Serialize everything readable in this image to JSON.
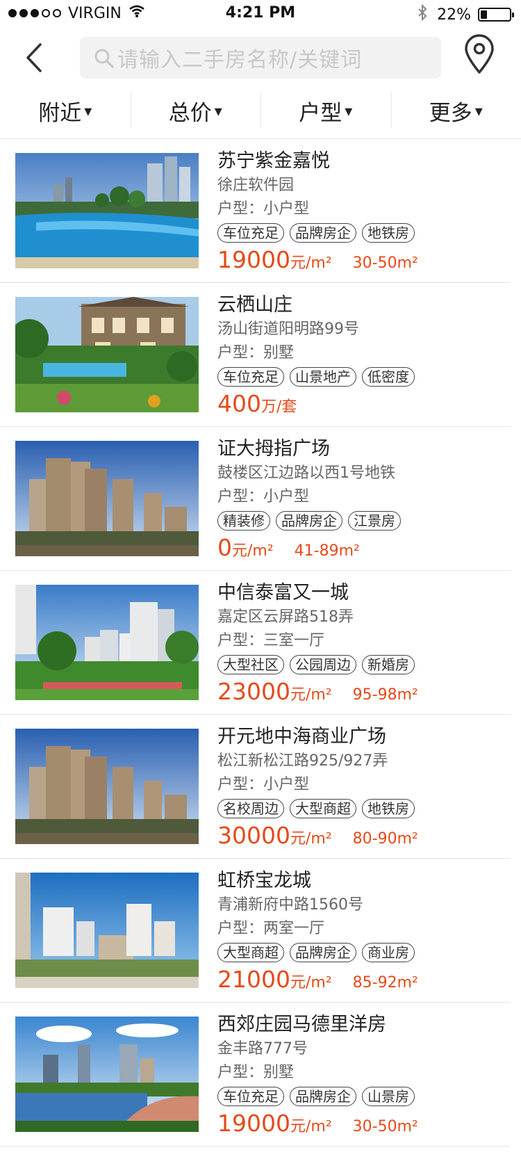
{
  "status_bar": {
    "carrier": "VIRGIN",
    "time": "4:21 PM",
    "battery_text": "22%",
    "battery_level": 0.22,
    "signal_dots_filled": 3,
    "signal_dots_total": 5
  },
  "header": {
    "search_placeholder": "请输入二手房名称/关键词",
    "back_icon": "chevron-left-icon",
    "location_icon": "map-pin-icon"
  },
  "filters": [
    {
      "label": "附近"
    },
    {
      "label": "总价"
    },
    {
      "label": "户型"
    },
    {
      "label": "更多"
    }
  ],
  "caret": "▾",
  "colors": {
    "accent": "#e64a19",
    "divider": "#e6e6e6",
    "search_bg": "#f2f2f2"
  },
  "listings": [
    {
      "name": "苏宁紫金嘉悦",
      "address": "徐庄软件园",
      "layout": "户型：小户型",
      "tags": [
        "车位充足",
        "品牌房企",
        "地铁房"
      ],
      "price": "19000",
      "unit": "元/m²",
      "area": "30-50m²",
      "image": "pool-resort"
    },
    {
      "name": "云栖山庄",
      "address": "汤山街道阳明路99号",
      "layout": "户型：别墅",
      "tags": [
        "车位充足",
        "山景地产",
        "低密度"
      ],
      "price": "400",
      "unit": "万/套",
      "area": "",
      "image": "villa-garden"
    },
    {
      "name": "证大拇指广场",
      "address": "鼓楼区江边路以西1号地铁",
      "layout": "户型：小户型",
      "tags": [
        "精装修",
        "品牌房企",
        "江景房"
      ],
      "price": "0",
      "unit": "元/m²",
      "area": "41-89m²",
      "image": "highrise-towers"
    },
    {
      "name": "中信泰富又一城",
      "address": "嘉定区云屏路518弄",
      "layout": "户型：三室一厅",
      "tags": [
        "大型社区",
        "公园周边",
        "新婚房"
      ],
      "price": "23000",
      "unit": "元/m²",
      "area": "95-98m²",
      "image": "park-towers"
    },
    {
      "name": "开元地中海商业广场",
      "address": "松江新松江路925/927弄",
      "layout": "户型：小户型",
      "tags": [
        "名校周边",
        "大型商超",
        "地铁房"
      ],
      "price": "30000",
      "unit": "元/m²",
      "area": "80-90m²",
      "image": "highrise-towers"
    },
    {
      "name": "虹桥宝龙城",
      "address": "青浦新府中路1560号",
      "layout": "户型：两室一厅",
      "tags": [
        "大型商超",
        "品牌房企",
        "商业房"
      ],
      "price": "21000",
      "unit": "元/m²",
      "area": "85-92m²",
      "image": "modern-blocks"
    },
    {
      "name": "西郊庄园马德里洋房",
      "address": "金丰路777号",
      "layout": "户型：别墅",
      "tags": [
        "车位充足",
        "品牌房企",
        "山景房"
      ],
      "price": "19000",
      "unit": "元/m²",
      "area": "30-50m²",
      "image": "lake-city"
    }
  ]
}
